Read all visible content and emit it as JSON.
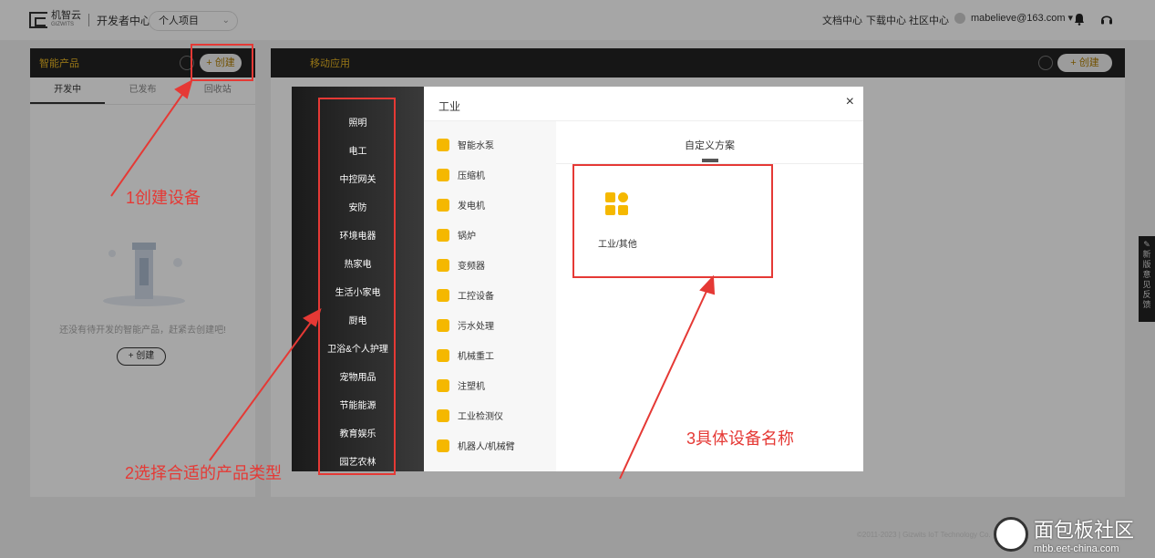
{
  "header": {
    "logo_text": "机智云",
    "logo_sub": "GIZWITS",
    "dev_center": "开发者中心",
    "project_select": "个人项目",
    "nav": [
      "文档中心",
      "下载中心",
      "社区中心"
    ],
    "user_email": "mabelieve@163.com ▾"
  },
  "left_panel": {
    "title": "智能产品",
    "create_label": "+ 创建",
    "tabs": [
      "开发中",
      "已发布",
      "回收站"
    ],
    "empty_text": "还没有待开发的智能产品，赶紧去创建吧!",
    "empty_create": "+ 创建"
  },
  "right_panel": {
    "title": "移动应用",
    "create_label": "+ 创建"
  },
  "feedback": [
    "新",
    "版",
    "意",
    "见",
    "反",
    "馈"
  ],
  "modal": {
    "title": "工业",
    "categories": [
      "照明",
      "电工",
      "中控网关",
      "安防",
      "环境电器",
      "热家电",
      "生活小家电",
      "厨电",
      "卫浴&个人护理",
      "宠物用品",
      "节能能源",
      "教育娱乐",
      "园艺农林"
    ],
    "subcategories": [
      "智能水泵",
      "压缩机",
      "发电机",
      "锅炉",
      "变频器",
      "工控设备",
      "污水处理",
      "机械重工",
      "注塑机",
      "工业检测仪",
      "机器人/机械臂"
    ],
    "detail_tab": "自定义方案",
    "card_label": "工业/其他"
  },
  "annotations": {
    "step1": "1创建设备",
    "step2": "2选择合适的产品类型",
    "step3": "3具体设备名称",
    "color": "#e53935"
  },
  "footer": "©2011-2023 | Gizwits IoT Technology Co.",
  "watermark": {
    "title": "面包板社区",
    "url": "mbb.eet-china.com"
  }
}
